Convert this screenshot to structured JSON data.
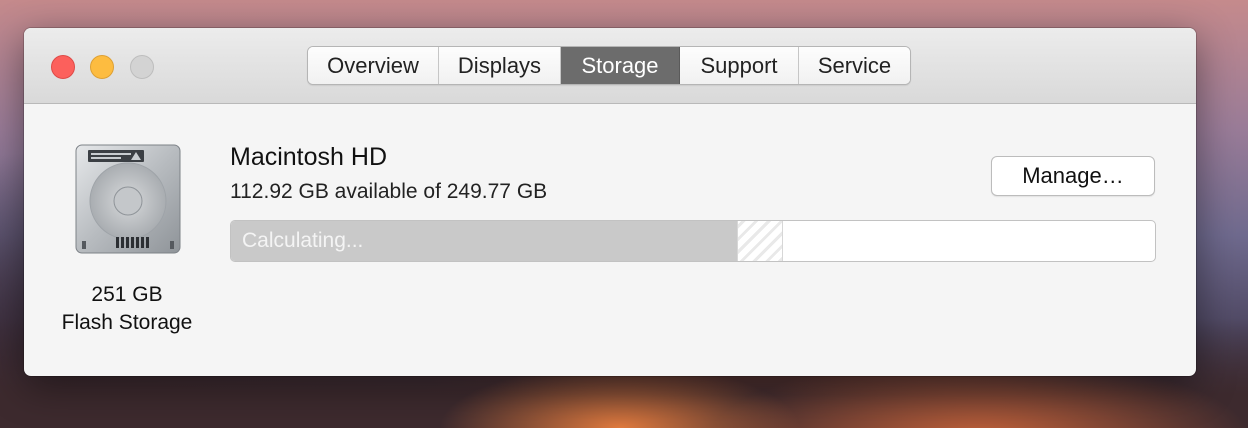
{
  "window": {
    "tabs": [
      {
        "label": "Overview",
        "active": false
      },
      {
        "label": "Displays",
        "active": false
      },
      {
        "label": "Storage",
        "active": true
      },
      {
        "label": "Support",
        "active": false
      },
      {
        "label": "Service",
        "active": false
      }
    ]
  },
  "disk": {
    "icon": "hard-drive-icon",
    "capacity": "251 GB",
    "type": "Flash Storage"
  },
  "volume": {
    "name": "Macintosh HD",
    "availability": "112.92 GB available of 249.77 GB",
    "manage_label": "Manage…",
    "usage": {
      "status_text": "Calculating...",
      "used_fraction": 0.548,
      "calculating_fraction": 0.049
    }
  },
  "colors": {
    "close": "#fc605c",
    "minimize": "#fdbc40",
    "zoom_disabled": "#d3d3d3",
    "active_tab": "#6c6c6c",
    "used_bar": "#c9c9c9"
  }
}
